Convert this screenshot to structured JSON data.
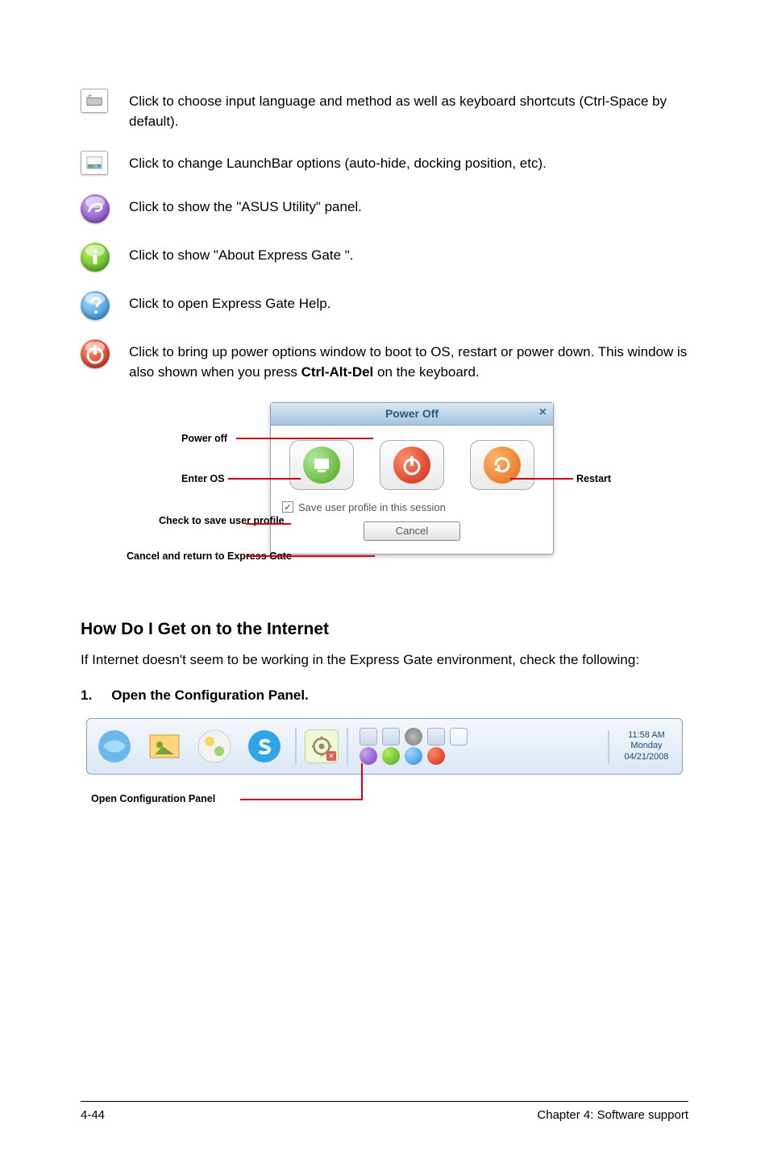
{
  "rows": [
    {
      "kind": "keyboard",
      "text": "Click to choose input language and method as well as keyboard shortcuts (Ctrl-Space by default)."
    },
    {
      "kind": "launchbar",
      "text": "Click to change LaunchBar options (auto-hide, docking position, etc)."
    },
    {
      "kind": "utility",
      "text": "Click to show the \"ASUS Utility\" panel."
    },
    {
      "kind": "info",
      "text": "Click to show \"About Express Gate \"."
    },
    {
      "kind": "help",
      "text": "Click to open Express Gate  Help."
    },
    {
      "kind": "power",
      "text_pre": "Click to bring up power options window to boot to OS, restart or power down. This window is also shown when you press ",
      "text_bold": "Ctrl-Alt-Del",
      "text_post": " on the keyboard."
    }
  ],
  "power_dialog": {
    "title": "Power Off",
    "save_profile": "Save user profile in this session",
    "cancel": "Cancel",
    "labels": {
      "power_off": "Power off",
      "enter_os": "Enter OS",
      "check_save": "Check to save user profile",
      "cancel_return": "Cancel and return to Express Gate",
      "restart": "Restart"
    }
  },
  "heading": "How Do I Get on to the Internet",
  "intro": "If Internet doesn't seem to be working in the Express Gate  environment, check the following:",
  "step1_num": "1.",
  "step1_text": "Open the Configuration Panel.",
  "launchbar": {
    "time": "11:58 AM",
    "day": "Monday",
    "date": "04/21/2008",
    "config_label": "Open Configuration Panel"
  },
  "footer": {
    "left": "4-44",
    "right": "Chapter 4: Software support"
  }
}
